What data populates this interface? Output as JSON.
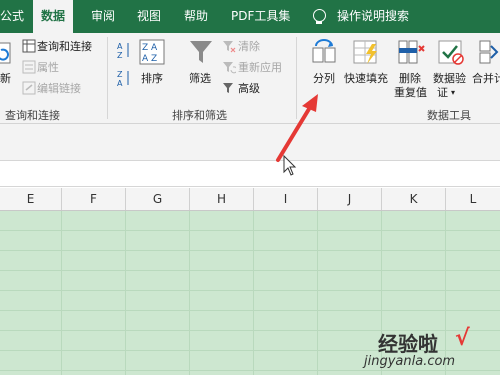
{
  "tabs": [
    {
      "label": "公式",
      "active": false
    },
    {
      "label": "数据",
      "active": true
    },
    {
      "label": "审阅",
      "active": false
    },
    {
      "label": "视图",
      "active": false
    },
    {
      "label": "帮助",
      "active": false
    },
    {
      "label": "PDF工具集",
      "active": false
    },
    {
      "label": "操作说明搜索",
      "active": false
    }
  ],
  "ribbon": {
    "query_group": {
      "refresh_label": "新",
      "query_connect": "查询和连接",
      "properties": "属性",
      "edit_links": "编辑链接",
      "group_label": "查询和连接"
    },
    "sort_group": {
      "sort_label": "排序",
      "filter_label": "筛选",
      "clear_label": "清除",
      "reapply_label": "重新应用",
      "advanced_label": "高级",
      "group_label": "排序和筛选"
    },
    "data_tools": {
      "text_to_columns": "分列",
      "flash_fill": "快速填充",
      "remove_dup_1": "删除",
      "remove_dup_2": "重复值",
      "validation_1": "数据验",
      "validation_2": "证",
      "consolidate": "合并计",
      "group_label": "数据工具"
    }
  },
  "columns": [
    "E",
    "F",
    "G",
    "H",
    "I",
    "J",
    "K",
    "L"
  ],
  "watermark": {
    "line1": "经验啦",
    "line2": "jingyanla.com",
    "check": "√"
  },
  "colors": {
    "excel_green": "#217346",
    "grid_fill": "#cde7d0",
    "arrow_red": "#e53935"
  }
}
